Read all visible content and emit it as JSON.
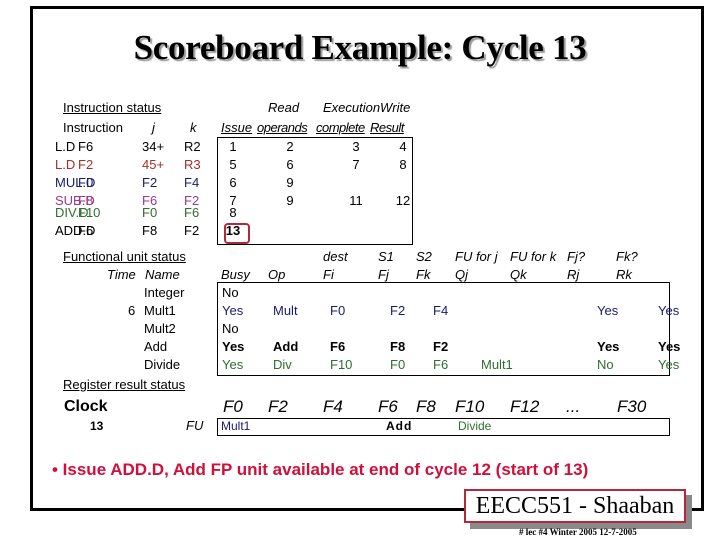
{
  "title": "Scoreboard Example:  Cycle 13",
  "instruction_status": {
    "section_label": "Instruction status",
    "headers": {
      "instruction": "Instruction",
      "j": "j",
      "k": "k",
      "issue": "Issue",
      "read_top": "Read",
      "read_bottom": "operands",
      "exec_top": "Execution",
      "exec_bottom": "complete",
      "write_top": "Write",
      "write_bottom": "Result"
    },
    "rows": [
      {
        "op": "L.D",
        "dest": "F6",
        "j": "34+",
        "k": "R2",
        "issue": "1",
        "read": "2",
        "exec": "3",
        "write": "4",
        "color": "#000000"
      },
      {
        "op": "L.D",
        "dest": "F2",
        "j": "45+",
        "k": "R3",
        "issue": "5",
        "read": "6",
        "exec": "7",
        "write": "8",
        "color": "#a0302a"
      },
      {
        "op": "MUL.D",
        "dest": "F0",
        "j": "F2",
        "k": "F4",
        "issue": "6",
        "read": "9",
        "exec": "",
        "write": "",
        "color": "#1a1a6e"
      },
      {
        "op": "SUB.D",
        "dest": "F8",
        "j": "F6",
        "k": "F2",
        "issue": "7",
        "read": "9",
        "exec": "11",
        "write": "12",
        "color": "#9a3a8a"
      },
      {
        "op": "DIV.D",
        "dest": "F10",
        "j": "F0",
        "k": "F6",
        "issue": "8",
        "read": "",
        "exec": "",
        "write": "",
        "color": "#2e6e2e"
      },
      {
        "op": "ADD.D",
        "dest": "F6",
        "j": "F8",
        "k": "F2",
        "issue": "13",
        "read": "",
        "exec": "",
        "write": "",
        "color": "#000000"
      }
    ]
  },
  "functional_unit_status": {
    "section_label": "Functional unit status",
    "headers": {
      "time": "Time",
      "name": "Name",
      "busy": "Busy",
      "op": "Op",
      "dest_top": "dest",
      "dest_bottom": "Fi",
      "s1_top": "S1",
      "s1_bottom": "Fj",
      "s2_top": "S2",
      "s2_bottom": "Fk",
      "qj_top": "FU for j",
      "qj_bottom": "Qj",
      "qk_top": "FU for k",
      "qk_bottom": "Qk",
      "rj_top": "Fj?",
      "rj_bottom": "Rj",
      "rk_top": "Fk?",
      "rk_bottom": "Rk"
    },
    "rows": [
      {
        "time": "",
        "name": "Integer",
        "busy": "No",
        "op": "",
        "fi": "",
        "fj": "",
        "fk": "",
        "qj": "",
        "qk": "",
        "rj": "",
        "rk": "",
        "color": "#000000"
      },
      {
        "time": "6",
        "name": "Mult1",
        "busy": "Yes",
        "op": "Mult",
        "fi": "F0",
        "fj": "F2",
        "fk": "F4",
        "qj": "",
        "qk": "",
        "rj": "Yes",
        "rk": "Yes",
        "color": "#1a1a6e"
      },
      {
        "time": "",
        "name": "Mult2",
        "busy": "No",
        "op": "",
        "fi": "",
        "fj": "",
        "fk": "",
        "qj": "",
        "qk": "",
        "rj": "",
        "rk": "",
        "color": "#000000"
      },
      {
        "time": "",
        "name": "Add",
        "busy": "Yes",
        "op": "Add",
        "fi": "F6",
        "fj": "F8",
        "fk": "F2",
        "qj": "",
        "qk": "",
        "rj": "Yes",
        "rk": "Yes",
        "color": "#000000",
        "bold": true
      },
      {
        "time": "",
        "name": "Divide",
        "busy": "Yes",
        "op": "Div",
        "fi": "F10",
        "fj": "F0",
        "fk": "F6",
        "qj": "Mult1",
        "qk": "",
        "rj": "No",
        "rk": "Yes",
        "color": "#2e6e2e"
      }
    ]
  },
  "register_result_status": {
    "section_label": "Register result status",
    "clock_label": "Clock",
    "clock_value": "13",
    "fu_label": "FU",
    "registers": [
      "F0",
      "F2",
      "F4",
      "F6",
      "F8",
      "F10",
      "F12",
      "...",
      "F30"
    ],
    "values": [
      "Mult1",
      "",
      "",
      "Add",
      "",
      "Divide",
      "",
      "",
      ""
    ]
  },
  "note": "• Issue ADD.D,  Add FP unit available at end of cycle 12 (start of 13)",
  "badge": "EECC551 - Shaaban",
  "footer": "#  lec #4  Winter 2005    12-7-2005",
  "colors": {
    "highlight": "#b4283c",
    "note": "#d0103a"
  }
}
